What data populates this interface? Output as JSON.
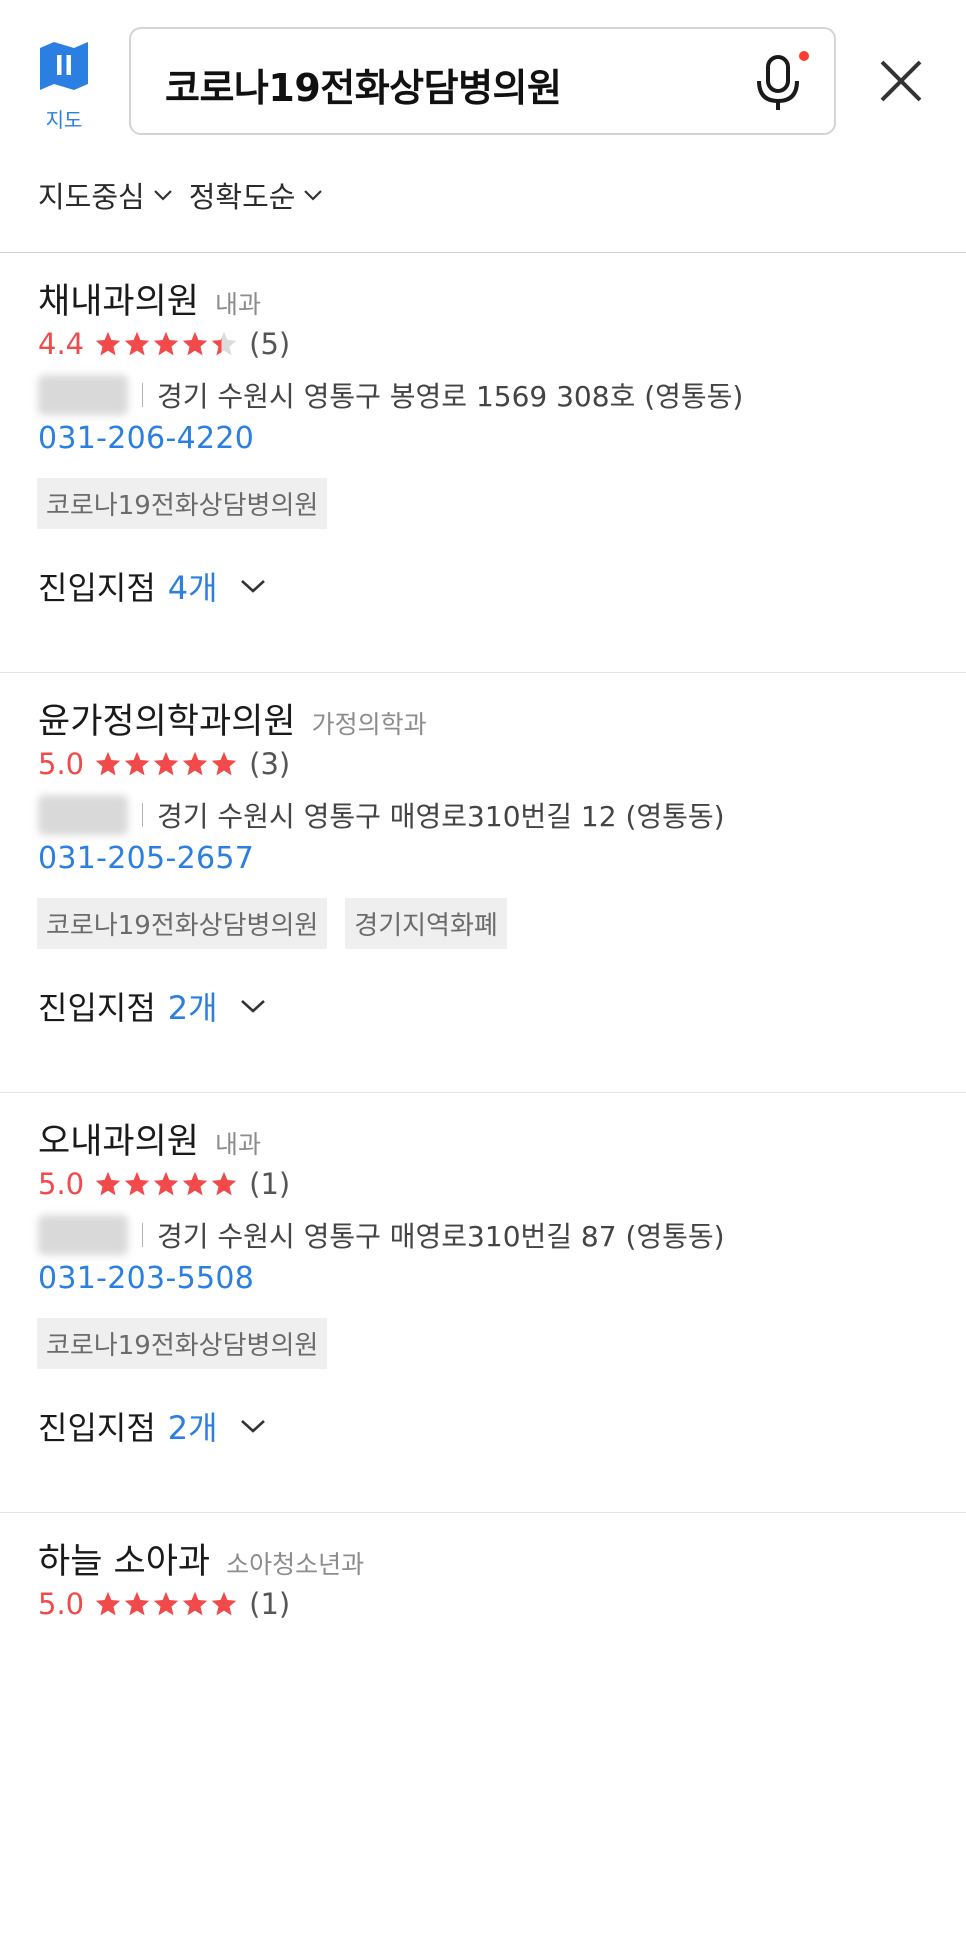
{
  "header": {
    "map_label": "지도",
    "search_value": "코로나19전화상담병의원",
    "filters": [
      "지도중심",
      "정확도순"
    ]
  },
  "colors": {
    "accent_blue": "#2a7fe0",
    "rating_red": "#f2494b",
    "mic_dot": "#ff3b30"
  },
  "results": [
    {
      "name": "채내과의원",
      "category": "내과",
      "score": "4.4",
      "stars": 4.4,
      "reviews": "(5)",
      "address": "경기 수원시 영통구 봉영로 1569 308호 (영통동)",
      "phone": "031-206-4220",
      "tags": [
        "코로나19전화상담병의원"
      ],
      "entry_label": "진입지점",
      "entry_count": "4개"
    },
    {
      "name": "윤가정의학과의원",
      "category": "가정의학과",
      "score": "5.0",
      "stars": 5,
      "reviews": "(3)",
      "address": "경기 수원시 영통구 매영로310번길 12 (영통동)",
      "phone": "031-205-2657",
      "tags": [
        "코로나19전화상담병의원",
        "경기지역화폐"
      ],
      "entry_label": "진입지점",
      "entry_count": "2개"
    },
    {
      "name": "오내과의원",
      "category": "내과",
      "score": "5.0",
      "stars": 5,
      "reviews": "(1)",
      "address": "경기 수원시 영통구 매영로310번길 87 (영통동)",
      "phone": "031-203-5508",
      "tags": [
        "코로나19전화상담병의원"
      ],
      "entry_label": "진입지점",
      "entry_count": "2개"
    },
    {
      "name": "하늘 소아과",
      "category": "소아청소년과",
      "score": "5.0",
      "stars": 5,
      "reviews": "(1)",
      "address": "",
      "phone": "",
      "tags": [],
      "entry_label": "",
      "entry_count": ""
    }
  ]
}
